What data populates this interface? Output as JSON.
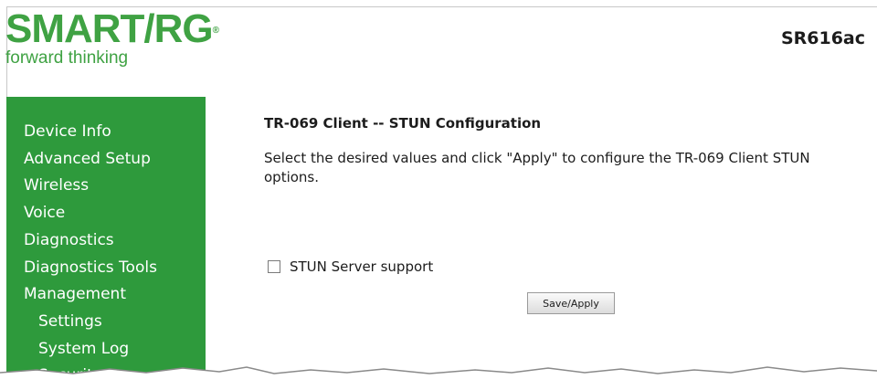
{
  "header": {
    "brand": "SMART/RG",
    "registered": "®",
    "tagline": "forward thinking",
    "model": "SR616ac"
  },
  "sidebar": {
    "items": [
      {
        "label": "Device Info"
      },
      {
        "label": "Advanced Setup"
      },
      {
        "label": "Wireless"
      },
      {
        "label": "Voice"
      },
      {
        "label": "Diagnostics"
      },
      {
        "label": "Diagnostics Tools"
      },
      {
        "label": "Management"
      },
      {
        "label": "Settings"
      },
      {
        "label": "System Log"
      },
      {
        "label": "Security Log"
      }
    ]
  },
  "main": {
    "title": "TR-069 Client -- STUN Configuration",
    "description_line1": "Select the desired values and click \"Apply\" to configure the TR-069 Client STUN",
    "description_line2": "options.",
    "stun_label": "STUN Server support",
    "stun_checked": false,
    "apply_label": "Save/Apply"
  },
  "colors": {
    "brand_green": "#3fa243",
    "sidebar_green": "#2e9a3c"
  }
}
